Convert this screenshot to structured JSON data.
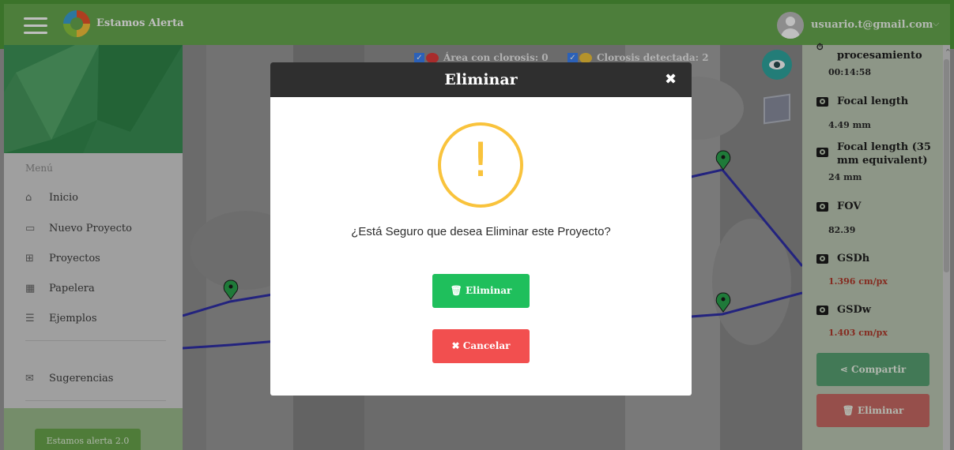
{
  "topbar": {
    "app_name": "Estamos Alerta",
    "user_email": "usuario.t@gmail.com",
    "user_chevron": "⌵"
  },
  "sidebar": {
    "menu_title": "Menú",
    "items": [
      {
        "label": "Inicio",
        "icon": "home-icon",
        "glyph": "⌂"
      },
      {
        "label": "Nuevo Proyecto",
        "icon": "new-project-icon",
        "glyph": "▭"
      },
      {
        "label": "Proyectos",
        "icon": "projects-grid-icon",
        "glyph": "⊞"
      },
      {
        "label": "Papelera",
        "icon": "trash-grid-icon",
        "glyph": "▦"
      },
      {
        "label": "Ejemplos",
        "icon": "list-icon",
        "glyph": "☰"
      },
      {
        "label": "Sugerencias",
        "icon": "mail-icon",
        "glyph": "✉"
      }
    ],
    "footer_button": "Estamos alerta 2.0"
  },
  "map": {
    "legend": [
      {
        "label": "Área con clorosis: 0",
        "swatch_color": "#e03b3b",
        "checked": true
      },
      {
        "label": "Clorosis detectada: 2",
        "swatch_color": "#f2c53a",
        "checked": true
      }
    ],
    "check_glyph": "✓"
  },
  "right_panel": {
    "processing_time_label": "procesamiento",
    "processing_time": "00:14:58",
    "focal_length_label": "Focal length",
    "focal_length": "4.49 mm",
    "focal_length_35_label_1": "Focal length (35",
    "focal_length_35_label_2": "mm equivalent)",
    "focal_length_35": "24 mm",
    "fov_label": "FOV",
    "fov": "82.39",
    "gsdh_label": "GSDh",
    "gsdh": "1.396 cm/px",
    "gsdw_label": "GSDw",
    "gsdw": "1.403 cm/px",
    "share_label": "Compartir",
    "delete_label": "Eliminar",
    "scroll_up_glyph": "^"
  },
  "modal": {
    "title": "Eliminar",
    "close_glyph": "✖",
    "warning_glyph": "!",
    "question": "¿Está Seguro que desea Eliminar este Proyecto?",
    "confirm_label": "🗑 Eliminar",
    "cancel_label": "✖ Cancelar"
  },
  "colors": {
    "brand_green": "#67a94f",
    "success": "#1fbf5c",
    "danger": "#f24f4f",
    "warning": "#f9c33c",
    "route": "#2f2fa8"
  }
}
